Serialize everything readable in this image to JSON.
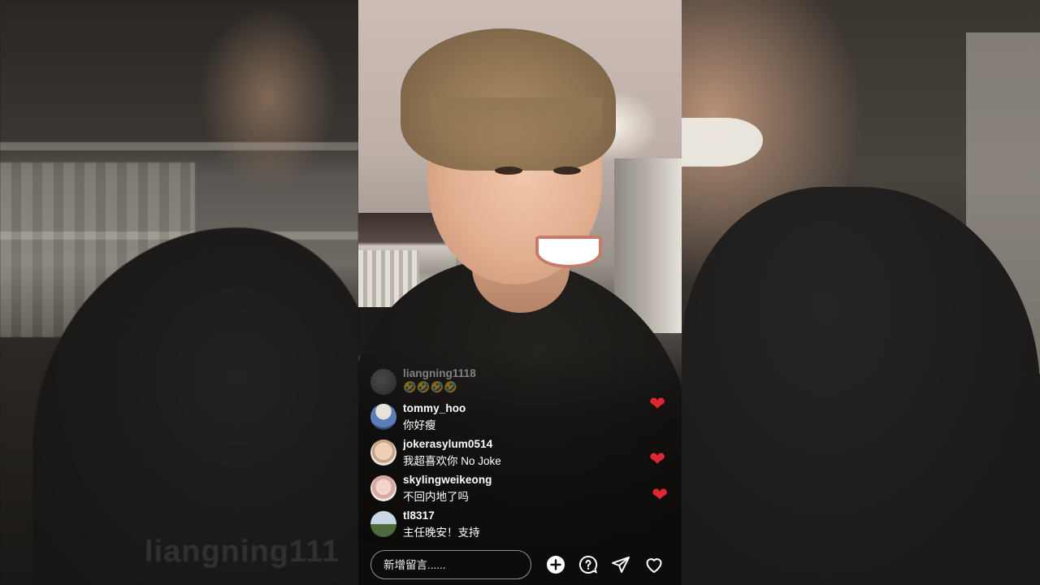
{
  "live": {
    "comments": [
      {
        "username": "liangning1118",
        "message": "🤣🤣🤣🤣",
        "avatar_icon": "avatar-grey-icon",
        "faded": true
      },
      {
        "username": "tommy_hoo",
        "message": "你好瘦",
        "avatar_icon": "avatar-blue-icon",
        "faded": false
      },
      {
        "username": "jokerasylum0514",
        "message": "我超喜欢你 No Joke",
        "avatar_icon": "avatar-face-icon",
        "faded": false
      },
      {
        "username": "skylingweikeong",
        "message": "不回内地了吗",
        "avatar_icon": "avatar-pink-icon",
        "faded": false
      },
      {
        "username": "tl8317",
        "message": "主任晚安！支持",
        "avatar_icon": "avatar-field-icon",
        "faded": false
      }
    ],
    "background_ghost_username": "liangning111",
    "input": {
      "placeholder": "新增留言......"
    },
    "actions": [
      {
        "name": "add-button",
        "icon": "plus-circle-icon"
      },
      {
        "name": "question-button",
        "icon": "question-bubble-icon"
      },
      {
        "name": "share-button",
        "icon": "paper-plane-icon"
      },
      {
        "name": "like-button",
        "icon": "heart-outline-icon"
      }
    ],
    "accent_color": "#e0262f"
  }
}
